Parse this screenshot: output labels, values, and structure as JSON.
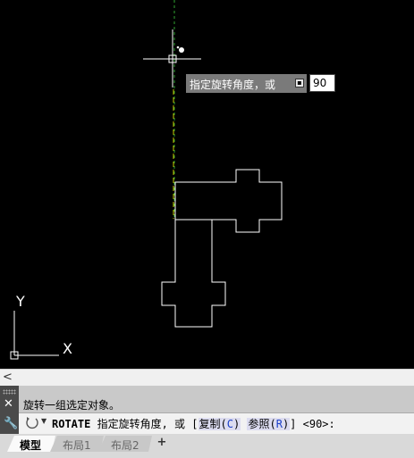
{
  "canvas": {
    "tooltip_text": "指定旋转角度，或",
    "tooltip_button_icon": "expand-icon",
    "angle_value": "90",
    "ucs_y_label": "Y",
    "ucs_x_label": "X"
  },
  "scrollbar": {
    "left_arrow": "<"
  },
  "command": {
    "history_line": "旋转一组选定对象。",
    "command_name": "ROTATE",
    "prompt": "指定旋转角度, 或 [",
    "option_copy_label": "复制",
    "option_copy_key": "C",
    "option_ref_label": "参照",
    "option_ref_key": "R",
    "suffix": "] <90>:",
    "close_icon": "close-icon",
    "customize_icon": "wrench-icon"
  },
  "tabs": [
    {
      "label": "模型",
      "active": true
    },
    {
      "label": "布局1",
      "active": false
    },
    {
      "label": "布局2",
      "active": false
    }
  ],
  "add_tab_label": "+",
  "colors": {
    "background": "#000000",
    "geometry": "#ffffff",
    "tooltip_bg": "#7a7a7a",
    "green_guide": "#2fa52f",
    "yellow_guide": "#c8c800"
  }
}
